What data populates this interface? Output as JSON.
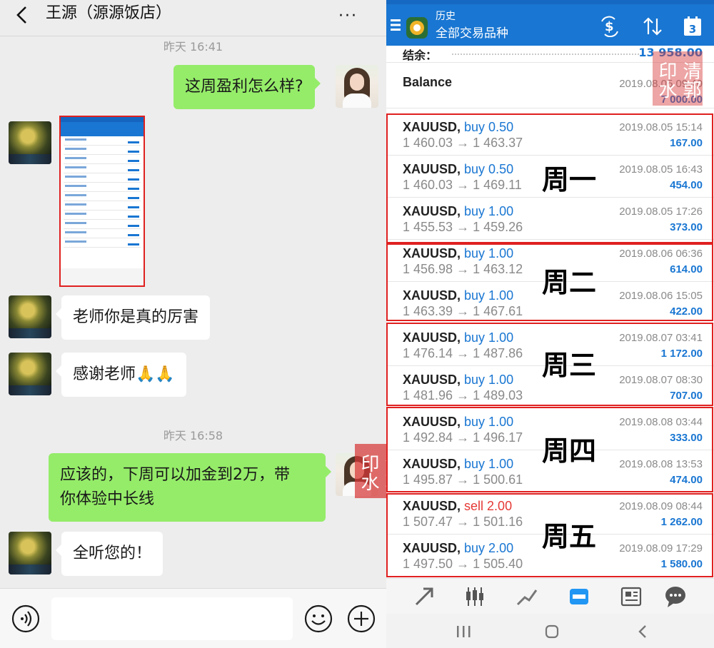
{
  "chat": {
    "title": "王源（源源饭店）",
    "more": "···",
    "timestamp1": "昨天 16:41",
    "timestamp2": "昨天 16:58",
    "messages": [
      {
        "from": "me",
        "text": "这周盈利怎么样?"
      },
      {
        "from": "other",
        "text": "[image]"
      },
      {
        "from": "other",
        "text": "老师你是真的厉害"
      },
      {
        "from": "other",
        "text": "感谢老师🙏🙏"
      },
      {
        "from": "me",
        "text": "应该的，下周可以加金到2万，带你体验中长线"
      },
      {
        "from": "other",
        "text": "全听您的！"
      }
    ],
    "msg_me_2_line1": "应该的，下周可以加金到2万，带",
    "msg_me_2_line2": "你体验中长线",
    "watermark": "清郭印水"
  },
  "mt": {
    "title": "历史",
    "subtitle": "全部交易品种",
    "calendar_day": "3",
    "summary_label": "结余：",
    "summary_value": "13 958.00",
    "balance": {
      "label": "Balance",
      "date": "2019.08.05 09:40",
      "amount": "7 000.00"
    },
    "deals": [
      {
        "symbol": "XAUUSD,",
        "side": "buy",
        "volume": "0.50",
        "side_text": "buy 0.50",
        "prices": "1 460.03 → 1 463.37",
        "time": "2019.08.05 15:14",
        "profit": "167.00"
      },
      {
        "symbol": "XAUUSD,",
        "side": "buy",
        "volume": "0.50",
        "side_text": "buy 0.50",
        "prices": "1 460.03 → 1 469.11",
        "time": "2019.08.05 16:43",
        "profit": "454.00"
      },
      {
        "symbol": "XAUUSD,",
        "side": "buy",
        "volume": "1.00",
        "side_text": "buy 1.00",
        "prices": "1 455.53 → 1 459.26",
        "time": "2019.08.05 17:26",
        "profit": "373.00"
      },
      {
        "symbol": "XAUUSD,",
        "side": "buy",
        "volume": "1.00",
        "side_text": "buy 1.00",
        "prices": "1 456.98 → 1 463.12",
        "time": "2019.08.06 06:36",
        "profit": "614.00"
      },
      {
        "symbol": "XAUUSD,",
        "side": "buy",
        "volume": "1.00",
        "side_text": "buy 1.00",
        "prices": "1 463.39 → 1 467.61",
        "time": "2019.08.06 15:05",
        "profit": "422.00"
      },
      {
        "symbol": "XAUUSD,",
        "side": "buy",
        "volume": "1.00",
        "side_text": "buy 1.00",
        "prices": "1 476.14 → 1 487.86",
        "time": "2019.08.07 03:41",
        "profit": "1 172.00"
      },
      {
        "symbol": "XAUUSD,",
        "side": "buy",
        "volume": "1.00",
        "side_text": "buy 1.00",
        "prices": "1 481.96 → 1 489.03",
        "time": "2019.08.07 08:30",
        "profit": "707.00"
      },
      {
        "symbol": "XAUUSD,",
        "side": "buy",
        "volume": "1.00",
        "side_text": "buy 1.00",
        "prices": "1 492.84 → 1 496.17",
        "time": "2019.08.08 03:44",
        "profit": "333.00"
      },
      {
        "symbol": "XAUUSD,",
        "side": "buy",
        "volume": "1.00",
        "side_text": "buy 1.00",
        "prices": "1 495.87 → 1 500.61",
        "time": "2019.08.08 13:53",
        "profit": "474.00"
      },
      {
        "symbol": "XAUUSD,",
        "side": "sell",
        "volume": "2.00",
        "side_text": "sell 2.00",
        "prices": "1 507.47 → 1 501.16",
        "time": "2019.08.09 08:44",
        "profit": "1 262.00"
      },
      {
        "symbol": "XAUUSD,",
        "side": "buy",
        "volume": "2.00",
        "side_text": "buy 2.00",
        "prices": "1 497.50 → 1 505.40",
        "time": "2019.08.09 17:29",
        "profit": "1 580.00"
      }
    ],
    "day_labels": [
      "周一",
      "周二",
      "周三",
      "周四",
      "周五"
    ],
    "nav_icons": [
      "trade-icon",
      "quotes-chart-icon",
      "chart-icon",
      "history-icon",
      "news-icon",
      "messages-icon"
    ],
    "active_nav": "history-icon"
  },
  "colors": {
    "mt_blue": "#1976d2",
    "sell_red": "#e53935",
    "bubble_green": "#95ec69",
    "highlight_red": "#e02020"
  }
}
